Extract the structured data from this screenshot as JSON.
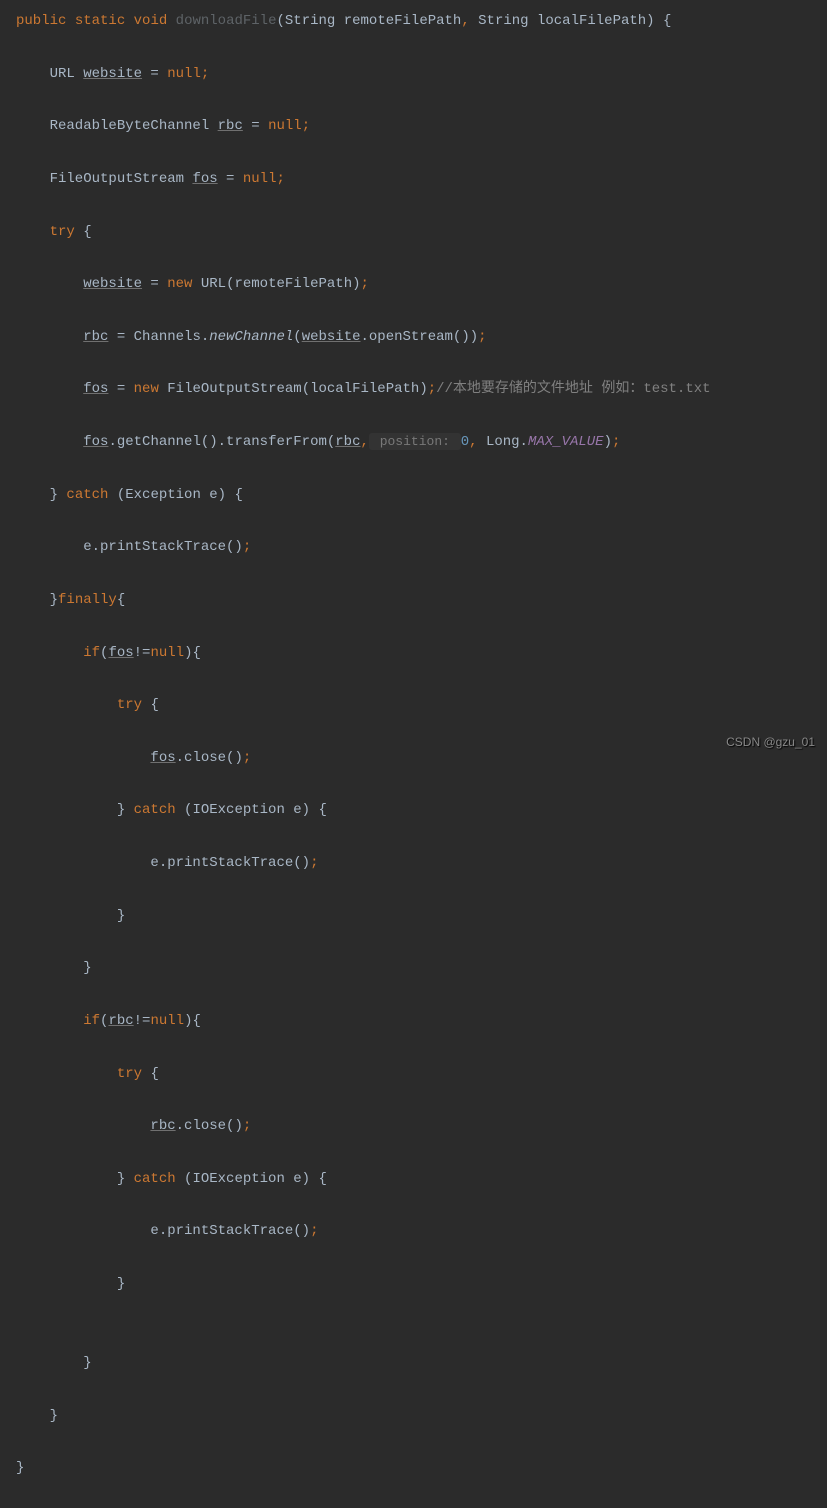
{
  "code": {
    "l1": {
      "kw1": "public",
      "kw2": "static",
      "kw3": "void",
      "method": "downloadFile",
      "sig": "(String remoteFilePath",
      "comma": ",",
      "sig2": " String localFilePath) {"
    },
    "l2": {
      "text1": "    URL ",
      "var": "website",
      "text2": " = ",
      "null": "null",
      "semi": ";"
    },
    "l3": {
      "text1": "    ReadableByteChannel ",
      "var": "rbc",
      "text2": " = ",
      "null": "null",
      "semi": ";"
    },
    "l4": {
      "text1": "    FileOutputStream ",
      "var": "fos",
      "text2": " = ",
      "null": "null",
      "semi": ";"
    },
    "l5": {
      "text1": "    ",
      "kw": "try",
      "text2": " {"
    },
    "l6": {
      "text1": "        ",
      "var": "website",
      "text2": " = ",
      "kw": "new",
      "text3": " URL(remoteFilePath)",
      "semi": ";"
    },
    "l7": {
      "text1": "        ",
      "var": "rbc",
      "text2": " = Channels.",
      "method": "newChannel",
      "text3": "(",
      "var2": "website",
      "text4": ".openStream())",
      "semi": ";"
    },
    "l8": {
      "text1": "        ",
      "var": "fos",
      "text2": " = ",
      "kw": "new",
      "text3": " FileOutputStream(localFilePath)",
      "semi": ";",
      "comment": "//本地要存储的文件地址 例如：test.txt"
    },
    "l9": {
      "text1": "        ",
      "var": "fos",
      "text2": ".getChannel().transferFrom(",
      "var2": "rbc",
      "text3": ",",
      "hint": " position: ",
      "num": "0",
      "text4": ",",
      "text5": " Long.",
      "field": "MAX_VALUE",
      "text6": ")",
      "semi": ";"
    },
    "l10": {
      "text1": "    } ",
      "kw": "catch",
      "text2": " (Exception e) {"
    },
    "l11": {
      "text1": "        e.printStackTrace()",
      "semi": ";"
    },
    "l12": {
      "text1": "    }",
      "kw": "finally",
      "text2": "{"
    },
    "l13": {
      "text1": "        ",
      "kw": "if",
      "text2": "(",
      "var": "fos",
      "text3": "!=",
      "null": "null",
      "text4": "){"
    },
    "l14": {
      "text1": "            ",
      "kw": "try",
      "text2": " {"
    },
    "l15": {
      "text1": "                ",
      "var": "fos",
      "text2": ".close()",
      "semi": ";"
    },
    "l16": {
      "text1": "            } ",
      "kw": "catch",
      "text2": " (IOException e) {"
    },
    "l17": {
      "text1": "                e.printStackTrace()",
      "semi": ";"
    },
    "l18": {
      "text1": "            }"
    },
    "l19": {
      "text1": "        }"
    },
    "l20": {
      "text1": "        ",
      "kw": "if",
      "text2": "(",
      "var": "rbc",
      "text3": "!=",
      "null": "null",
      "text4": "){"
    },
    "l21": {
      "text1": "            ",
      "kw": "try",
      "text2": " {"
    },
    "l22": {
      "text1": "                ",
      "var": "rbc",
      "text2": ".close()",
      "semi": ";"
    },
    "l23": {
      "text1": "            } ",
      "kw": "catch",
      "text2": " (IOException e) {"
    },
    "l24": {
      "text1": "                e.printStackTrace()",
      "semi": ";"
    },
    "l25": {
      "text1": "            }"
    },
    "l26": {
      "text1": ""
    },
    "l27": {
      "text1": "        }"
    },
    "l28": {
      "text1": "    }"
    },
    "l29": {
      "text1": "}"
    }
  },
  "watermark": "CSDN @gzu_01"
}
